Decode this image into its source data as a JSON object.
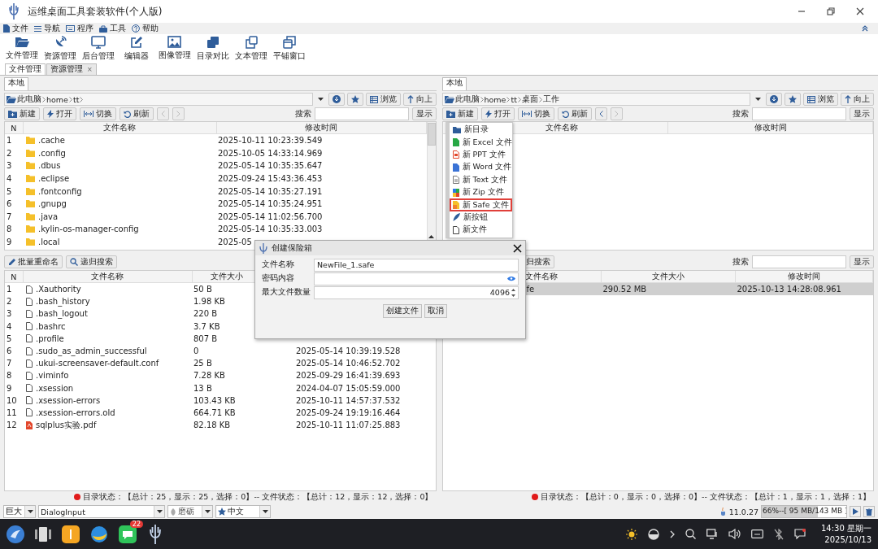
{
  "window": {
    "title": "运维桌面工具套装软件(个人版)"
  },
  "menu_bar": [
    {
      "label": "文件",
      "kind": "file"
    },
    {
      "label": "导航",
      "kind": "list"
    },
    {
      "label": "程序",
      "kind": "keyboard"
    },
    {
      "label": "工具",
      "kind": "toolbox"
    },
    {
      "label": "帮助",
      "kind": "help"
    }
  ],
  "toolbar": [
    {
      "label": "文件管理",
      "kind": "folder"
    },
    {
      "label": "资源管理",
      "kind": "dish"
    },
    {
      "label": "后台管理",
      "kind": "monitor"
    },
    {
      "label": "编辑器",
      "kind": "edit"
    },
    {
      "label": "图像管理",
      "kind": "image"
    },
    {
      "label": "目录对比",
      "kind": "stack"
    },
    {
      "label": "文本管理",
      "kind": "copy"
    },
    {
      "label": "平铺窗口",
      "kind": "windows"
    }
  ],
  "tabs": [
    {
      "label": "文件管理",
      "selected": true
    },
    {
      "label": "资源管理",
      "selected": false,
      "close": "×"
    }
  ],
  "panes": [
    {
      "tab": {
        "label": "本地",
        "selected": true
      },
      "path": [
        "此电脑",
        "home",
        "tt"
      ],
      "path_buttons": [
        {
          "label": "浏览",
          "kind": "browse"
        },
        {
          "label": "向上",
          "kind": "up"
        }
      ],
      "toolbar": [
        {
          "label": "新建",
          "kind": "new"
        },
        {
          "label": "打开",
          "kind": "open"
        },
        {
          "label": "切换",
          "kind": "switch"
        },
        {
          "label": "刷新",
          "kind": "refresh"
        }
      ],
      "nav": {
        "back_enabled": false,
        "forward_enabled": false
      },
      "search": {
        "label": "搜索",
        "button": "显示"
      },
      "upper_table": {
        "columns": [
          "N",
          "文件名称",
          "修改时间"
        ],
        "rows": [
          {
            "n": "1",
            "name": ".cache",
            "kind": "folder",
            "time": "2025-10-11 10:23:39.549",
            "selected": false
          },
          {
            "n": "2",
            "name": ".config",
            "kind": "folder",
            "time": "2025-10-05 14:33:14.969",
            "selected": false
          },
          {
            "n": "3",
            "name": ".dbus",
            "kind": "folder",
            "time": "2025-05-14 10:35:35.647",
            "selected": false
          },
          {
            "n": "4",
            "name": ".eclipse",
            "kind": "folder",
            "time": "2025-09-24 15:43:36.453",
            "selected": false
          },
          {
            "n": "5",
            "name": ".fontconfig",
            "kind": "folder",
            "time": "2025-05-14 10:35:27.191",
            "selected": false
          },
          {
            "n": "6",
            "name": ".gnupg",
            "kind": "folder",
            "time": "2025-05-14 10:35:24.951",
            "selected": false
          },
          {
            "n": "7",
            "name": ".java",
            "kind": "folder",
            "time": "2025-05-14 11:02:56.700",
            "selected": false
          },
          {
            "n": "8",
            "name": ".kylin-os-manager-config",
            "kind": "folder",
            "time": "2025-05-14 10:35:33.003",
            "selected": false
          },
          {
            "n": "9",
            "name": ".local",
            "kind": "folder",
            "time": "2025-05",
            "selected": false
          }
        ]
      },
      "lower_toolbar": [
        {
          "label": "批量重命名",
          "kind": "rename"
        },
        {
          "label": "递归搜索",
          "kind": "search"
        }
      ],
      "lower_table": {
        "columns": [
          "N",
          "文件名称",
          "文件大小"
        ],
        "rows": [
          {
            "n": "1",
            "name": ".Xauthority",
            "kind": "file",
            "size": "50 B",
            "selected": false
          },
          {
            "n": "2",
            "name": ".bash_history",
            "kind": "file",
            "size": "1.98 KB",
            "selected": false
          },
          {
            "n": "3",
            "name": ".bash_logout",
            "kind": "file",
            "size": "220 B",
            "selected": false
          },
          {
            "n": "4",
            "name": ".bashrc",
            "kind": "file",
            "size": "3.7 KB",
            "selected": false
          },
          {
            "n": "5",
            "name": ".profile",
            "kind": "file",
            "size": "807 B",
            "selected": false
          },
          {
            "n": "6",
            "name": ".sudo_as_admin_successful",
            "kind": "file",
            "size": "0",
            "time": "2025-05-14 10:39:19.528",
            "selected": false
          },
          {
            "n": "7",
            "name": ".ukui-screensaver-default.conf",
            "kind": "file",
            "size": "25 B",
            "time": "2025-05-14 10:46:52.702",
            "selected": false
          },
          {
            "n": "8",
            "name": ".viminfo",
            "kind": "file",
            "size": "7.28 KB",
            "time": "2025-09-29 16:41:39.693",
            "selected": false
          },
          {
            "n": "9",
            "name": ".xsession",
            "kind": "file",
            "size": "13 B",
            "time": "2024-04-07 15:05:59.000",
            "selected": false
          },
          {
            "n": "10",
            "name": ".xsession-errors",
            "kind": "file",
            "size": "103.43 KB",
            "time": "2025-10-11 14:57:37.532",
            "selected": false
          },
          {
            "n": "11",
            "name": ".xsession-errors.old",
            "kind": "file",
            "size": "664.71 KB",
            "time": "2025-09-24 19:19:16.464",
            "selected": false
          },
          {
            "n": "12",
            "name": "sqlplus实验.pdf",
            "kind": "pdf",
            "size": "82.18 KB",
            "time": "2025-10-11 11:07:25.883",
            "selected": false
          }
        ]
      },
      "status": "目录状态：【总计：25，显示：25，选择：0】-- 文件状态：【总计：12，显示：12，选择：0】"
    },
    {
      "tab": {
        "label": "本地",
        "selected": true
      },
      "path": [
        "此电脑",
        "home",
        "tt",
        "桌面",
        "工作"
      ],
      "path_buttons": [
        {
          "label": "浏览",
          "kind": "browse"
        },
        {
          "label": "向上",
          "kind": "up"
        }
      ],
      "toolbar": [
        {
          "label": "新建",
          "kind": "new"
        },
        {
          "label": "打开",
          "kind": "open"
        },
        {
          "label": "切换",
          "kind": "switch"
        },
        {
          "label": "刷新",
          "kind": "refresh"
        }
      ],
      "nav": {
        "back_enabled": true,
        "forward_enabled": false
      },
      "search": {
        "label": "搜索",
        "button": "显示"
      },
      "upper_table": {
        "columns": [
          "文件名称",
          "修改时间"
        ]
      },
      "lower_toolbar": [
        {
          "label": "归搜索",
          "kind": "partial"
        }
      ],
      "lower_search": {
        "label": "搜索",
        "button": "显示"
      },
      "lower_table": {
        "columns": [
          "文件名称",
          "文件大小",
          "修改时间"
        ],
        "rows": [
          {
            "name": "fe",
            "size": "290.52 MB",
            "time": "2025-10-13 14:28:08.961",
            "selected": true
          }
        ]
      },
      "new_menu": [
        {
          "label": "新目录",
          "kind": "folder",
          "highlighted": false
        },
        {
          "label": "新 Excel 文件",
          "kind": "excel",
          "highlighted": false
        },
        {
          "label": "新 PPT 文件",
          "kind": "ppt",
          "highlighted": false
        },
        {
          "label": "新 Word 文件",
          "kind": "word",
          "highlighted": false
        },
        {
          "label": "新 Text 文件",
          "kind": "text",
          "highlighted": false
        },
        {
          "label": "新 Zip 文件",
          "kind": "zip",
          "highlighted": false
        },
        {
          "label": "新 Safe 文件",
          "kind": "safe",
          "highlighted": true
        },
        {
          "label": "新按钮",
          "kind": "feather",
          "highlighted": false
        },
        {
          "label": "新文件",
          "kind": "blank",
          "highlighted": false
        }
      ],
      "status": "目录状态：【总计：0，显示：0，选择：0】-- 文件状态：【总计：1，显示：1，选择：1】"
    }
  ],
  "dialog": {
    "title": "创建保险箱",
    "fields": [
      {
        "label": "文件名称",
        "value": "NewFile_1.safe",
        "kind": "text"
      },
      {
        "label": "密码内容",
        "kind": "password"
      },
      {
        "label": "最大文件数量",
        "value": "4096",
        "kind": "number"
      }
    ],
    "buttons": [
      "创建文件",
      "取消"
    ]
  },
  "bottom_bar": {
    "options": [
      {
        "value": "巨大",
        "kind": "small"
      },
      {
        "value": "DialogInput",
        "kind": "wide"
      },
      {
        "value": "磨砺",
        "kind": "leaf"
      },
      {
        "value": "中文",
        "kind": "star"
      }
    ],
    "java_version": "11.0.27",
    "memory": {
      "text": "66%--[ 95 MB/143 MB ]",
      "level": 0.66
    }
  },
  "taskbar": {
    "badge": "22",
    "time": "14:30 星期一",
    "date": "2025/10/13"
  }
}
